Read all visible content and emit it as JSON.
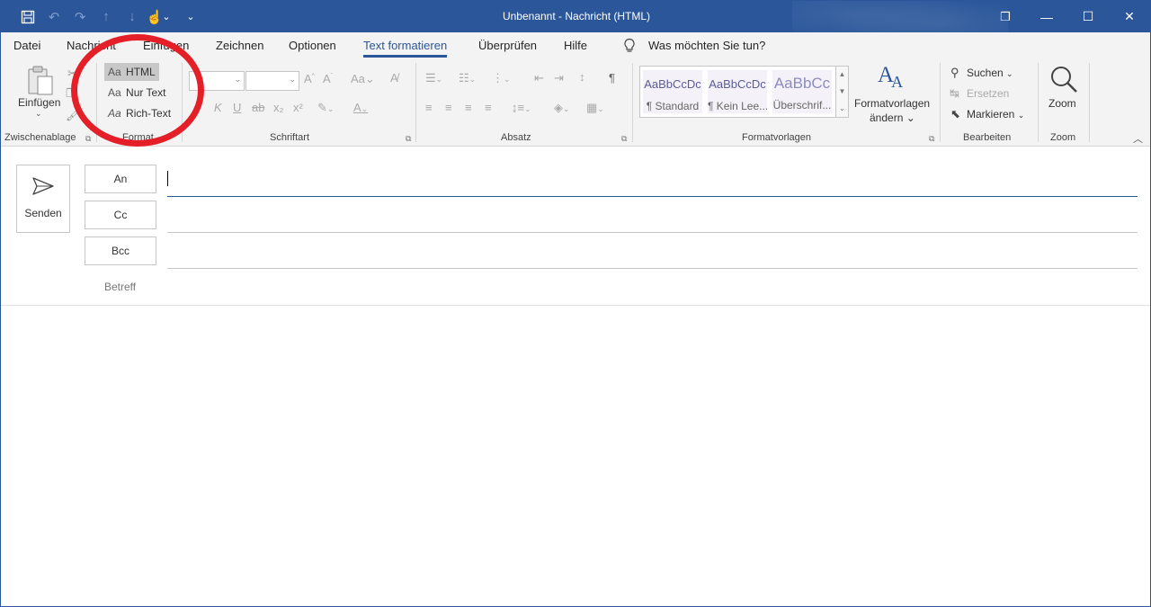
{
  "window": {
    "title": "Unbenannt  -  Nachricht (HTML)",
    "minimize_glyph": "—",
    "maximize_glyph": "☐",
    "restore_glyph": "❐",
    "close_glyph": "✕"
  },
  "qat": {
    "save_glyph": "💾",
    "undo_glyph": "↶",
    "redo_glyph": "↷",
    "up_glyph": "↑",
    "down_glyph": "↓",
    "touch_glyph": "☝",
    "caret_glyph": "⌄",
    "customize_glyph": "⌄"
  },
  "menu": {
    "tabs": [
      "Datei",
      "Nachricht",
      "Einfügen",
      "Zeichnen",
      "Optionen",
      "Text formatieren",
      "Überprüfen",
      "Hilfe"
    ],
    "active": "Text formatieren",
    "tell_me": "Was möchten Sie tun?"
  },
  "ribbon": {
    "clipboard": {
      "paste_label": "Einfügen",
      "group_label": "Zwischenablage"
    },
    "format": {
      "group_label": "Format",
      "html": "HTML",
      "plain": "Nur Text",
      "rich": "Rich-Text",
      "aa": "Aa"
    },
    "font": {
      "group_label": "Schriftart",
      "italic": "K",
      "underline": "U",
      "strike": "ab",
      "sub": "x₂",
      "sup": "x²"
    },
    "paragraph": {
      "group_label": "Absatz",
      "pilcrow": "¶"
    },
    "styles": {
      "group_label": "Formatvorlagen",
      "items": [
        {
          "preview": "AaBbCcDc",
          "name": "¶ Standard"
        },
        {
          "preview": "AaBbCcDc",
          "name": "¶ Kein Lee..."
        },
        {
          "preview": "AaBbCc",
          "name": "Überschrif..."
        }
      ],
      "change_line1": "Formatvorlagen",
      "change_line2": "ändern ⌄"
    },
    "editing": {
      "group_label": "Bearbeiten",
      "find": "Suchen",
      "replace": "Ersetzen",
      "select": "Markieren"
    },
    "zoom": {
      "group_label": "Zoom",
      "label": "Zoom"
    }
  },
  "compose": {
    "send_label": "Senden",
    "to_label": "An",
    "cc_label": "Cc",
    "bcc_label": "Bcc",
    "subject_label": "Betreff"
  },
  "colors": {
    "accent": "#2b579a",
    "annotation": "#e41f28",
    "ribbon_bg": "#f3f3f3"
  }
}
